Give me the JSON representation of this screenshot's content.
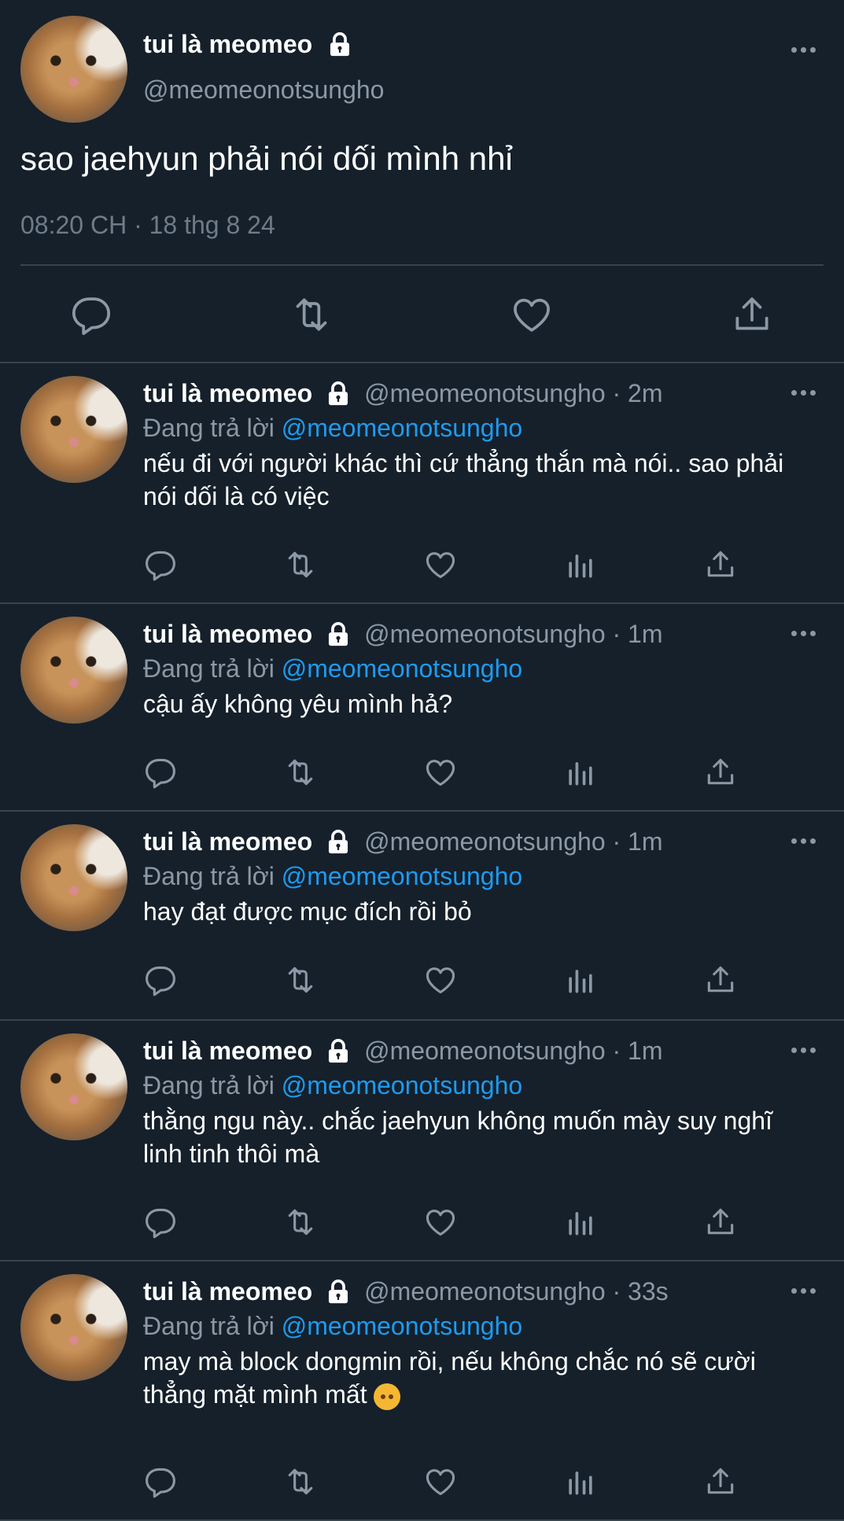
{
  "author": {
    "name": "tui là meomeo",
    "handle": "@meomeonotsungho"
  },
  "main_tweet": {
    "text": "sao jaehyun phải nói dối mình nhỉ",
    "timestamp": "08:20 CH · 18 thg 8 24"
  },
  "reply_prefix": "Đang trả lời",
  "icons": {
    "lock": "lock-icon",
    "more": "more-icon",
    "reply": "reply-icon",
    "retweet": "retweet-icon",
    "like": "heart-icon",
    "views": "analytics-icon",
    "share": "share-icon"
  },
  "replies": [
    {
      "meta": "@meomeonotsungho · 2m",
      "reply_to": "@meomeonotsungho",
      "text": "nếu đi với người khác thì cứ thẳng thắn mà nói.. sao phải nói dối là có việc"
    },
    {
      "meta": "@meomeonotsungho · 1m",
      "reply_to": "@meomeonotsungho",
      "text": "cậu ấy không yêu mình hả?"
    },
    {
      "meta": "@meomeonotsungho · 1m",
      "reply_to": "@meomeonotsungho",
      "text": "hay đạt được mục đích rồi bỏ"
    },
    {
      "meta": "@meomeonotsungho · 1m",
      "reply_to": "@meomeonotsungho",
      "text": "thằng ngu này.. chắc jaehyun không muốn mày suy nghĩ linh tinh thôi mà"
    },
    {
      "meta": "@meomeonotsungho · 33s",
      "reply_to": "@meomeonotsungho",
      "text": "may mà block dongmin rồi, nếu không chắc nó sẽ cười thẳng mặt mình mất"
    }
  ],
  "colors": {
    "background": "#15202b",
    "divider": "#38444d",
    "secondary_text": "#8b98a5",
    "link": "#1d9bf0"
  }
}
